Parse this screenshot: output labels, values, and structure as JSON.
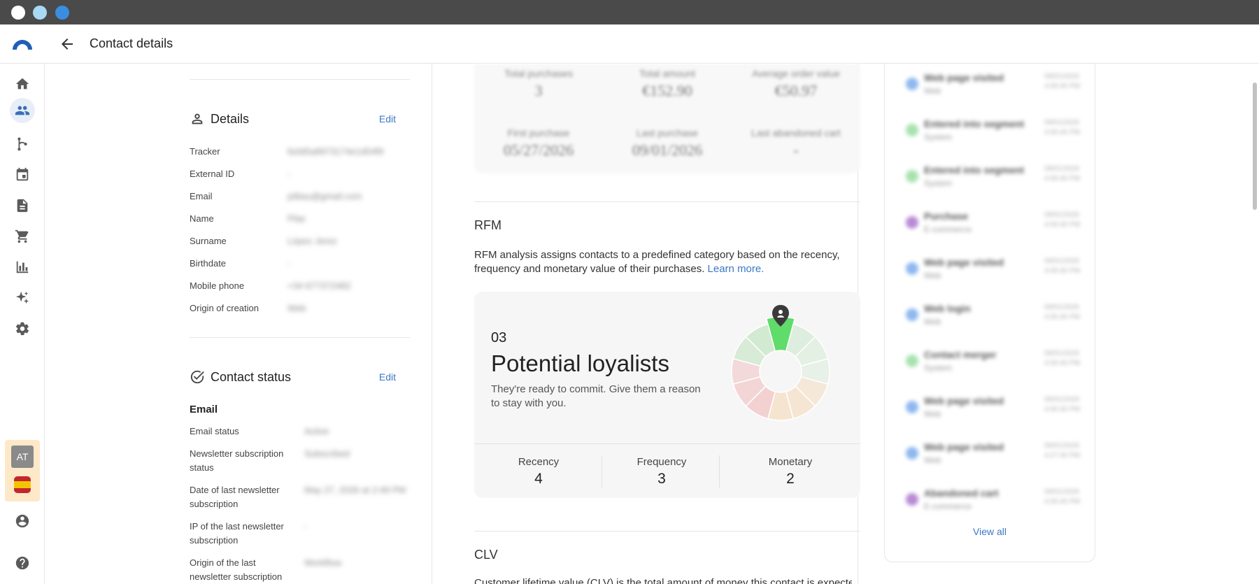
{
  "window": {
    "traffic_colors": [
      "#ffffff",
      "#a9d8f5",
      "#3b8de0"
    ]
  },
  "header": {
    "title": "Contact details"
  },
  "sidebar": {
    "items": [
      "home-icon",
      "contacts-icon",
      "workflow-icon",
      "calendar-icon",
      "document-icon",
      "cart-icon",
      "chart-icon",
      "sparkle-icon",
      "gear-icon"
    ],
    "account_initials": "AT"
  },
  "details": {
    "title": "Details",
    "edit_label": "Edit",
    "fields": [
      {
        "label": "Tracker",
        "value": "fa3d5a8973174e1d54f9"
      },
      {
        "label": "External ID",
        "value": "-"
      },
      {
        "label": "Email",
        "value": "pilitau@gmail.com"
      },
      {
        "label": "Name",
        "value": "Pilar"
      },
      {
        "label": "Surname",
        "value": "López Jerez"
      },
      {
        "label": "Birthdate",
        "value": "-"
      },
      {
        "label": "Mobile phone",
        "value": "+34 677372482"
      },
      {
        "label": "Origin of creation",
        "value": "Web"
      }
    ]
  },
  "contact_status": {
    "title": "Contact status",
    "edit_label": "Edit",
    "email_heading": "Email",
    "fields": [
      {
        "label": "Email status",
        "value": "Active"
      },
      {
        "label": "Newsletter subscription status",
        "value": "Subscribed"
      },
      {
        "label": "Date of last newsletter subscription",
        "value": "May 27, 2026 at 2:49 PM"
      },
      {
        "label": "IP of the last newsletter subscription",
        "value": "-"
      },
      {
        "label": "Origin of the last newsletter subscription",
        "value": "Workflow"
      }
    ]
  },
  "purchases": {
    "stats": [
      {
        "label": "Total purchases",
        "value": "3"
      },
      {
        "label": "Total amount",
        "value": "€152.90"
      },
      {
        "label": "Average order value",
        "value": "€50.97"
      },
      {
        "label": "First purchase",
        "value": "05/27/2026"
      },
      {
        "label": "Last purchase",
        "value": "09/01/2026"
      },
      {
        "label": "Last abandoned cart",
        "value": "-"
      }
    ]
  },
  "rfm": {
    "title": "RFM",
    "description": "RFM analysis assigns contacts to a predefined category based on the recency, frequency and monetary value of their purchases.",
    "learn_more": "Learn more.",
    "code": "03",
    "segment": "Potential loyalists",
    "segment_description": "They're ready to commit. Give them a reason to stay with you.",
    "metrics": [
      {
        "label": "Recency",
        "value": "4"
      },
      {
        "label": "Frequency",
        "value": "3"
      },
      {
        "label": "Monetary",
        "value": "2"
      }
    ],
    "wheel_colors": {
      "active": "#5fdc6a",
      "greens": "#cfe9cf",
      "reds": "#f2cfcf",
      "oranges": "#f5e3cc"
    }
  },
  "clv": {
    "title": "CLV",
    "description": "Customer lifetime value (CLV) is the total amount of money this contact is expected"
  },
  "activity": {
    "items": [
      {
        "title": "Web page visited",
        "sub": "Web",
        "date": "09/01/2026",
        "time": "4:00:40 PM",
        "color": "#8fb8f0"
      },
      {
        "title": "Entered into segment",
        "sub": "System",
        "date": "09/01/2026",
        "time": "4:00:40 PM",
        "color": "#a8e2b0"
      },
      {
        "title": "Entered into segment",
        "sub": "System",
        "date": "09/01/2026",
        "time": "4:00:40 PM",
        "color": "#a8e2b0"
      },
      {
        "title": "Purchase",
        "sub": "E-commerce",
        "date": "09/01/2026",
        "time": "4:00:40 PM",
        "color": "#b98ad6"
      },
      {
        "title": "Web page visited",
        "sub": "Web",
        "date": "09/01/2026",
        "time": "4:00:40 PM",
        "color": "#8fb8f0"
      },
      {
        "title": "Web login",
        "sub": "Web",
        "date": "09/01/2026",
        "time": "4:00:40 PM",
        "color": "#8fb8f0"
      },
      {
        "title": "Contact merger",
        "sub": "System",
        "date": "09/01/2026",
        "time": "4:00:40 PM",
        "color": "#a8e2b0"
      },
      {
        "title": "Web page visited",
        "sub": "Web",
        "date": "09/01/2026",
        "time": "4:00:40 PM",
        "color": "#8fb8f0"
      },
      {
        "title": "Web page visited",
        "sub": "Web",
        "date": "09/01/2026",
        "time": "4:27:40 PM",
        "color": "#8fb8f0"
      },
      {
        "title": "Abandoned cart",
        "sub": "E-commerce",
        "date": "09/01/2026",
        "time": "4:00:40 PM",
        "color": "#b98ad6"
      }
    ],
    "view_all": "View all"
  }
}
